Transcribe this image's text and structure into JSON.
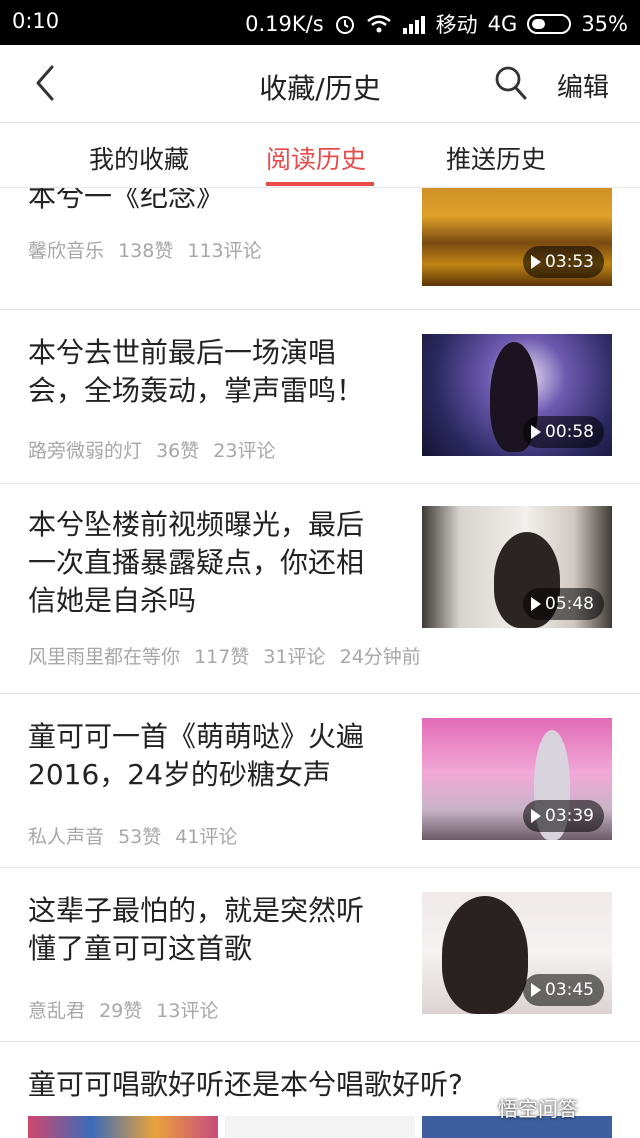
{
  "status_bar": {
    "time": "0:10",
    "speed": "0.19K/s",
    "carrier": "移动",
    "network": "4G",
    "battery": "35%"
  },
  "header": {
    "title": "收藏/历史",
    "edit": "编辑"
  },
  "tabs": [
    {
      "label": "我的收藏",
      "active": false
    },
    {
      "label": "阅读历史",
      "active": true
    },
    {
      "label": "推送历史",
      "active": false
    }
  ],
  "items": [
    {
      "title": "本兮一《纪念》",
      "author": "馨欣音乐",
      "likes": "138赞",
      "comments": "113评论",
      "time": "",
      "duration": "03:53"
    },
    {
      "title": "本兮去世前最后一场演唱会，全场轰动，掌声雷鸣！",
      "author": "路旁微弱的灯",
      "likes": "36赞",
      "comments": "23评论",
      "time": "",
      "duration": "00:58"
    },
    {
      "title": "本兮坠楼前视频曝光，最后一次直播暴露疑点，你还相信她是自杀吗",
      "author": "风里雨里都在等你",
      "likes": "117赞",
      "comments": "31评论",
      "time": "24分钟前",
      "duration": "05:48"
    },
    {
      "title": "童可可一首《萌萌哒》火遍2016，24岁的砂糖女声",
      "author": "私人声音",
      "likes": "53赞",
      "comments": "41评论",
      "time": "",
      "duration": "03:39"
    },
    {
      "title": "这辈子最怕的，就是突然听懂了童可可这首歌",
      "author": "意乱君",
      "likes": "29赞",
      "comments": "13评论",
      "time": "",
      "duration": "03:45"
    },
    {
      "title": "童可可唱歌好听还是本兮唱歌好听?",
      "author": "",
      "likes": "",
      "comments": "",
      "time": "",
      "duration": ""
    }
  ],
  "watermark": "悟空问答",
  "colors": {
    "accent": "#e94b4b",
    "meta": "#a7a7a7"
  },
  "icons": [
    "back-arrow-icon",
    "search-icon",
    "play-icon",
    "wifi-icon",
    "signal-icon",
    "alarm-icon",
    "battery-icon"
  ]
}
